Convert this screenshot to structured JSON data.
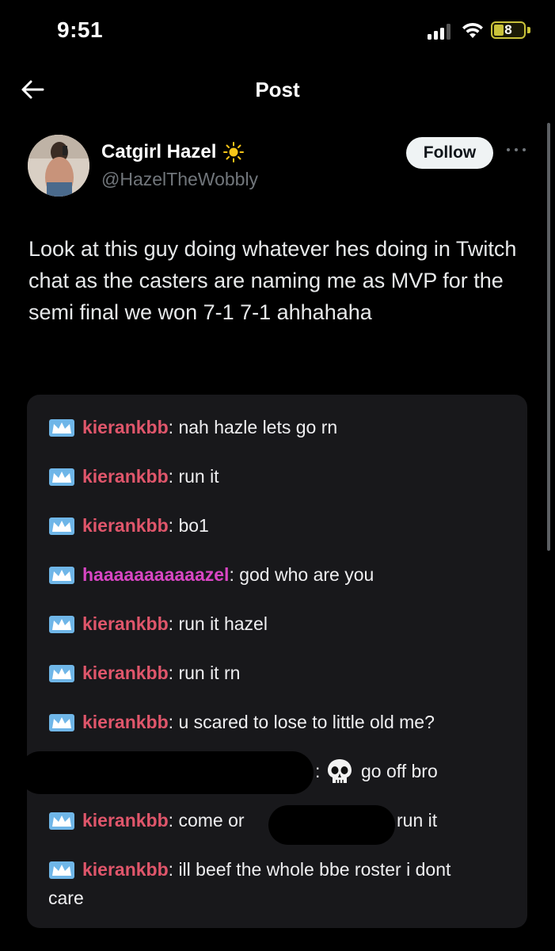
{
  "status_bar": {
    "time": "9:51",
    "battery_level": "8"
  },
  "nav": {
    "title": "Post"
  },
  "author": {
    "display_name": "Catgirl Hazel",
    "handle": "@HazelTheWobbly",
    "follow_label": "Follow"
  },
  "post": {
    "text": "Look at this guy doing whatever hes doing in Twitch chat as the casters are naming me as MVP for the semi final we won 7-1 7-1 ahhahaha"
  },
  "chat": {
    "messages": [
      {
        "user": "kierankbb",
        "sep": ": ",
        "text": "nah hazle lets go rn"
      },
      {
        "user": "kierankbb",
        "sep": ": ",
        "text": "run it"
      },
      {
        "user": "kierankbb",
        "sep": ": ",
        "text": "bo1"
      },
      {
        "user": "haaaaaaaaaaazel",
        "sep": ": ",
        "text": "god who are you"
      },
      {
        "user": "kierankbb",
        "sep": ": ",
        "text": "run it hazel"
      },
      {
        "user": "kierankbb",
        "sep": ": ",
        "text": "run it rn"
      },
      {
        "user": "kierankbb",
        "sep": ": ",
        "text": "u scared to lose to little old me?"
      },
      {
        "user": "",
        "sep": ":",
        "text": "go off bro"
      },
      {
        "user": "kierankbb",
        "sep": ": ",
        "text": "come or",
        "text_after": "run it"
      },
      {
        "user": "kierankbb",
        "sep": ": ",
        "text": "ill beef the whole bbe roster i dont",
        "text_wrap": "care"
      }
    ]
  },
  "colors": {
    "accent_username": "#e0566b",
    "accent_pink": "#d946c4",
    "crown_badge": "#6fb6e8",
    "battery": "#c9c23a"
  }
}
